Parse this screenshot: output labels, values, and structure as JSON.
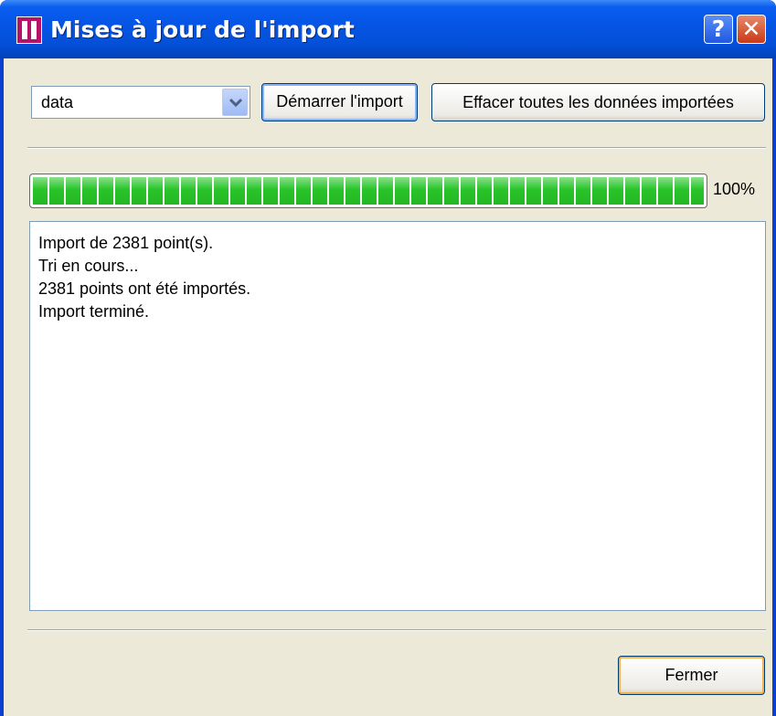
{
  "window": {
    "title": "Mises à jour de l'import",
    "help_label": "?",
    "close_label": "✕",
    "accent_color": "#0554e3"
  },
  "toolbar": {
    "source_select": {
      "value": "data"
    },
    "start_button": "Démarrer l'import",
    "clear_button": "Effacer toutes les données importées"
  },
  "progress": {
    "value": 1.0,
    "label": "100%",
    "fill_color": "#29c429"
  },
  "log": {
    "lines": [
      "Import de 2381 point(s).",
      "Tri en cours...",
      "2381 points ont été importés.",
      "Import terminé."
    ]
  },
  "footer": {
    "close_button": "Fermer"
  }
}
